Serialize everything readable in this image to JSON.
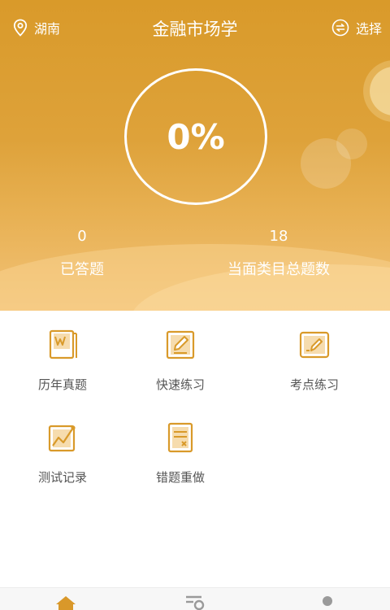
{
  "header": {
    "location": "湖南",
    "title": "金融市场学",
    "select_label": "选择"
  },
  "progress": {
    "percent_text": "0%",
    "percent_value": 0
  },
  "stats": {
    "answered": {
      "value": "0",
      "label": "已答题"
    },
    "total": {
      "value": "18",
      "label": "当面类目总题数"
    }
  },
  "menu": {
    "items": [
      {
        "label": "历年真题",
        "icon": "past-exam-book-icon"
      },
      {
        "label": "快速练习",
        "icon": "quick-practice-pencil-icon"
      },
      {
        "label": "考点练习",
        "icon": "keypoint-practice-icon"
      },
      {
        "label": "测试记录",
        "icon": "test-record-chart-icon"
      },
      {
        "label": "错题重做",
        "icon": "wrong-question-redo-icon"
      }
    ]
  },
  "bottom_nav": {
    "items": [
      {
        "icon": "home-icon",
        "active": true
      },
      {
        "icon": "list-search-icon",
        "active": false
      },
      {
        "icon": "profile-icon",
        "active": false
      }
    ]
  },
  "colors": {
    "accent": "#d9982a",
    "hero_top": "#d99a2a",
    "hero_bottom": "#f2c277",
    "icon": "#d99a2a",
    "nav_inactive": "#9a9a9a"
  }
}
